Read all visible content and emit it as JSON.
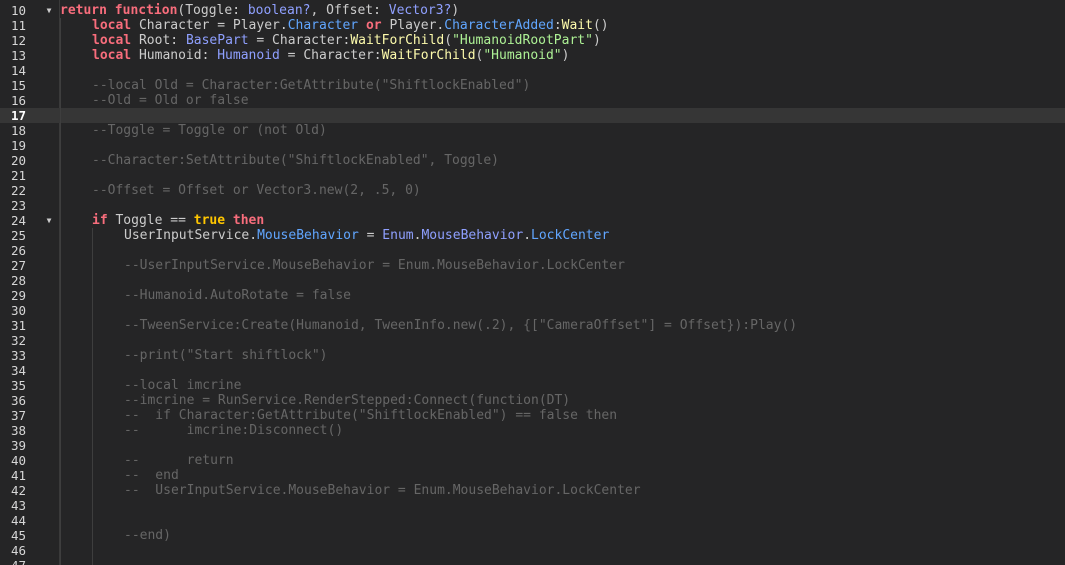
{
  "colors": {
    "background": "#252526",
    "currentLine": "#363636",
    "lineNumber": "#d6d6d6",
    "keyword": "#f86d7c",
    "text": "#cccccc",
    "type": "#8fa0ff",
    "property": "#61a6ff",
    "method": "#fdfbac",
    "string": "#adf195",
    "comment": "#666666",
    "bool": "#ffc600"
  },
  "lines": [
    {
      "num": "10",
      "indent": 0,
      "fold": "▼",
      "tokens": [
        [
          "return function",
          "keyword"
        ],
        [
          "(Toggle: ",
          "text"
        ],
        [
          "boolean?",
          "type"
        ],
        [
          ", Offset: ",
          "text"
        ],
        [
          "Vector3?",
          "type"
        ],
        [
          ")",
          "text"
        ]
      ]
    },
    {
      "num": "11",
      "indent": 1,
      "tokens": [
        [
          "local",
          "keyword"
        ],
        [
          " Character = Player.",
          "text"
        ],
        [
          "Character",
          "property"
        ],
        [
          " ",
          "text"
        ],
        [
          "or",
          "keyword"
        ],
        [
          " Player.",
          "text"
        ],
        [
          "CharacterAdded",
          "property"
        ],
        [
          ":",
          "text"
        ],
        [
          "Wait",
          "method"
        ],
        [
          "()",
          "text"
        ]
      ]
    },
    {
      "num": "12",
      "indent": 1,
      "tokens": [
        [
          "local",
          "keyword"
        ],
        [
          " Root: ",
          "text"
        ],
        [
          "BasePart",
          "type"
        ],
        [
          " = Character:",
          "text"
        ],
        [
          "WaitForChild",
          "method"
        ],
        [
          "(",
          "text"
        ],
        [
          "\"HumanoidRootPart\"",
          "string"
        ],
        [
          ")",
          "text"
        ]
      ]
    },
    {
      "num": "13",
      "indent": 1,
      "tokens": [
        [
          "local",
          "keyword"
        ],
        [
          " Humanoid: ",
          "text"
        ],
        [
          "Humanoid",
          "type"
        ],
        [
          " = Character:",
          "text"
        ],
        [
          "WaitForChild",
          "method"
        ],
        [
          "(",
          "text"
        ],
        [
          "\"Humanoid\"",
          "string"
        ],
        [
          ")",
          "text"
        ]
      ]
    },
    {
      "num": "14",
      "indent": 1,
      "tokens": []
    },
    {
      "num": "15",
      "indent": 1,
      "tokens": [
        [
          "--local Old = Character:GetAttribute(\"ShiftlockEnabled\")",
          "comment"
        ]
      ]
    },
    {
      "num": "16",
      "indent": 1,
      "tokens": [
        [
          "--Old = Old or false",
          "comment"
        ]
      ]
    },
    {
      "num": "17",
      "indent": 1,
      "current": true,
      "tokens": []
    },
    {
      "num": "18",
      "indent": 1,
      "tokens": [
        [
          "--Toggle = Toggle or (not Old)",
          "comment"
        ]
      ]
    },
    {
      "num": "19",
      "indent": 1,
      "tokens": []
    },
    {
      "num": "20",
      "indent": 1,
      "tokens": [
        [
          "--Character:SetAttribute(\"ShiftlockEnabled\", Toggle)",
          "comment"
        ]
      ]
    },
    {
      "num": "21",
      "indent": 1,
      "tokens": []
    },
    {
      "num": "22",
      "indent": 1,
      "tokens": [
        [
          "--Offset = Offset or Vector3.new(2, .5, 0)",
          "comment"
        ]
      ]
    },
    {
      "num": "23",
      "indent": 1,
      "tokens": []
    },
    {
      "num": "24",
      "indent": 1,
      "fold": "▼",
      "tokens": [
        [
          "if",
          "keyword"
        ],
        [
          " Toggle == ",
          "text"
        ],
        [
          "true",
          "bool"
        ],
        [
          " ",
          "text"
        ],
        [
          "then",
          "keyword"
        ]
      ]
    },
    {
      "num": "25",
      "indent": 2,
      "tokens": [
        [
          "UserInputService.",
          "text"
        ],
        [
          "MouseBehavior",
          "property"
        ],
        [
          " = ",
          "text"
        ],
        [
          "Enum",
          "type"
        ],
        [
          ".",
          "text"
        ],
        [
          "MouseBehavior",
          "type"
        ],
        [
          ".",
          "text"
        ],
        [
          "LockCenter",
          "property"
        ]
      ]
    },
    {
      "num": "26",
      "indent": 2,
      "tokens": []
    },
    {
      "num": "27",
      "indent": 2,
      "tokens": [
        [
          "--UserInputService.MouseBehavior = Enum.MouseBehavior.LockCenter",
          "comment"
        ]
      ]
    },
    {
      "num": "28",
      "indent": 2,
      "tokens": []
    },
    {
      "num": "29",
      "indent": 2,
      "tokens": [
        [
          "--Humanoid.AutoRotate = false",
          "comment"
        ]
      ]
    },
    {
      "num": "30",
      "indent": 2,
      "tokens": []
    },
    {
      "num": "31",
      "indent": 2,
      "tokens": [
        [
          "--TweenService:Create(Humanoid, TweenInfo.new(.2), {[\"CameraOffset\"] = Offset}):Play()",
          "comment"
        ]
      ]
    },
    {
      "num": "32",
      "indent": 2,
      "tokens": []
    },
    {
      "num": "33",
      "indent": 2,
      "tokens": [
        [
          "--print(\"Start shiftlock\")",
          "comment"
        ]
      ]
    },
    {
      "num": "34",
      "indent": 2,
      "tokens": []
    },
    {
      "num": "35",
      "indent": 2,
      "tokens": [
        [
          "--local imcrine",
          "comment"
        ]
      ]
    },
    {
      "num": "36",
      "indent": 2,
      "tokens": [
        [
          "--imcrine = RunService.RenderStepped:Connect(function(DT)",
          "comment"
        ]
      ]
    },
    {
      "num": "37",
      "indent": 2,
      "tokens": [
        [
          "--  if Character:GetAttribute(\"ShiftlockEnabled\") == false then",
          "comment"
        ]
      ]
    },
    {
      "num": "38",
      "indent": 2,
      "tokens": [
        [
          "--      imcrine:Disconnect()",
          "comment"
        ]
      ]
    },
    {
      "num": "39",
      "indent": 2,
      "tokens": []
    },
    {
      "num": "40",
      "indent": 2,
      "tokens": [
        [
          "--      return",
          "comment"
        ]
      ]
    },
    {
      "num": "41",
      "indent": 2,
      "tokens": [
        [
          "--  end",
          "comment"
        ]
      ]
    },
    {
      "num": "42",
      "indent": 2,
      "tokens": [
        [
          "--  UserInputService.MouseBehavior = Enum.MouseBehavior.LockCenter",
          "comment"
        ]
      ]
    },
    {
      "num": "43",
      "indent": 2,
      "tokens": []
    },
    {
      "num": "44",
      "indent": 2,
      "tokens": []
    },
    {
      "num": "45",
      "indent": 2,
      "tokens": [
        [
          "--end)",
          "comment"
        ]
      ]
    },
    {
      "num": "46",
      "indent": 2,
      "tokens": []
    },
    {
      "num": "47",
      "indent": 2,
      "tokens": []
    }
  ]
}
